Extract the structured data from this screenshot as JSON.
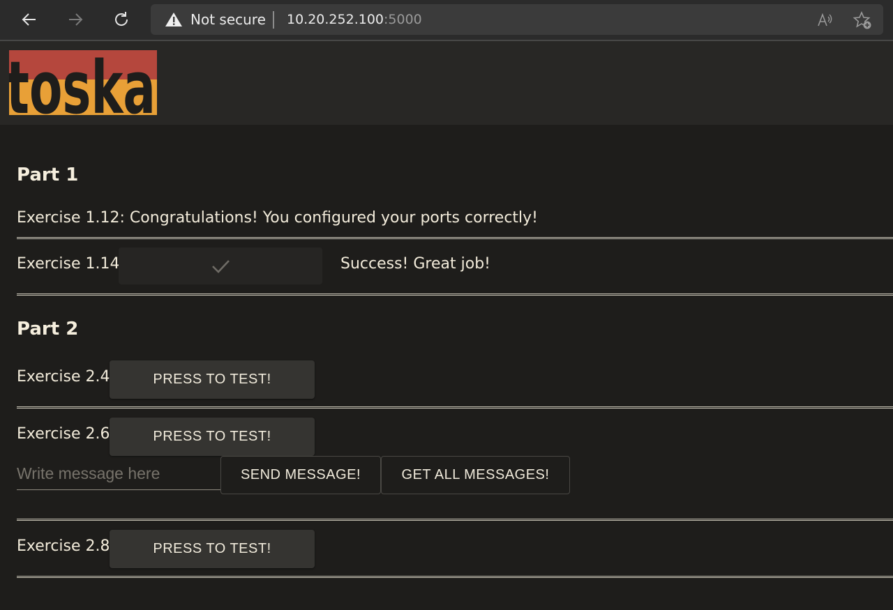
{
  "browser": {
    "security_label": "Not secure",
    "url_host": "10.20.252.100",
    "url_port": ":5000"
  },
  "logo_text": "toska",
  "part1": {
    "title": "Part 1",
    "ex_1_12": "Exercise 1.12: Congratulations! You configured your ports correctly!",
    "ex_1_14_label": "Exercise 1.14:",
    "ex_1_14_result": "Success! Great job!"
  },
  "part2": {
    "title": "Part 2",
    "ex_2_4_label": "Exercise 2.4:",
    "ex_2_6_label": "Exercise 2.6:",
    "ex_2_8_label": "Exercise 2.8:",
    "test_button": "PRESS TO TEST!",
    "message_placeholder": "Write message here",
    "send_button": "SEND MESSAGE!",
    "get_all_button": "GET ALL MESSAGES!"
  },
  "colors": {
    "background": "#1e1d1b",
    "logo_red": "#b5473d",
    "logo_orange": "#e8a037"
  }
}
